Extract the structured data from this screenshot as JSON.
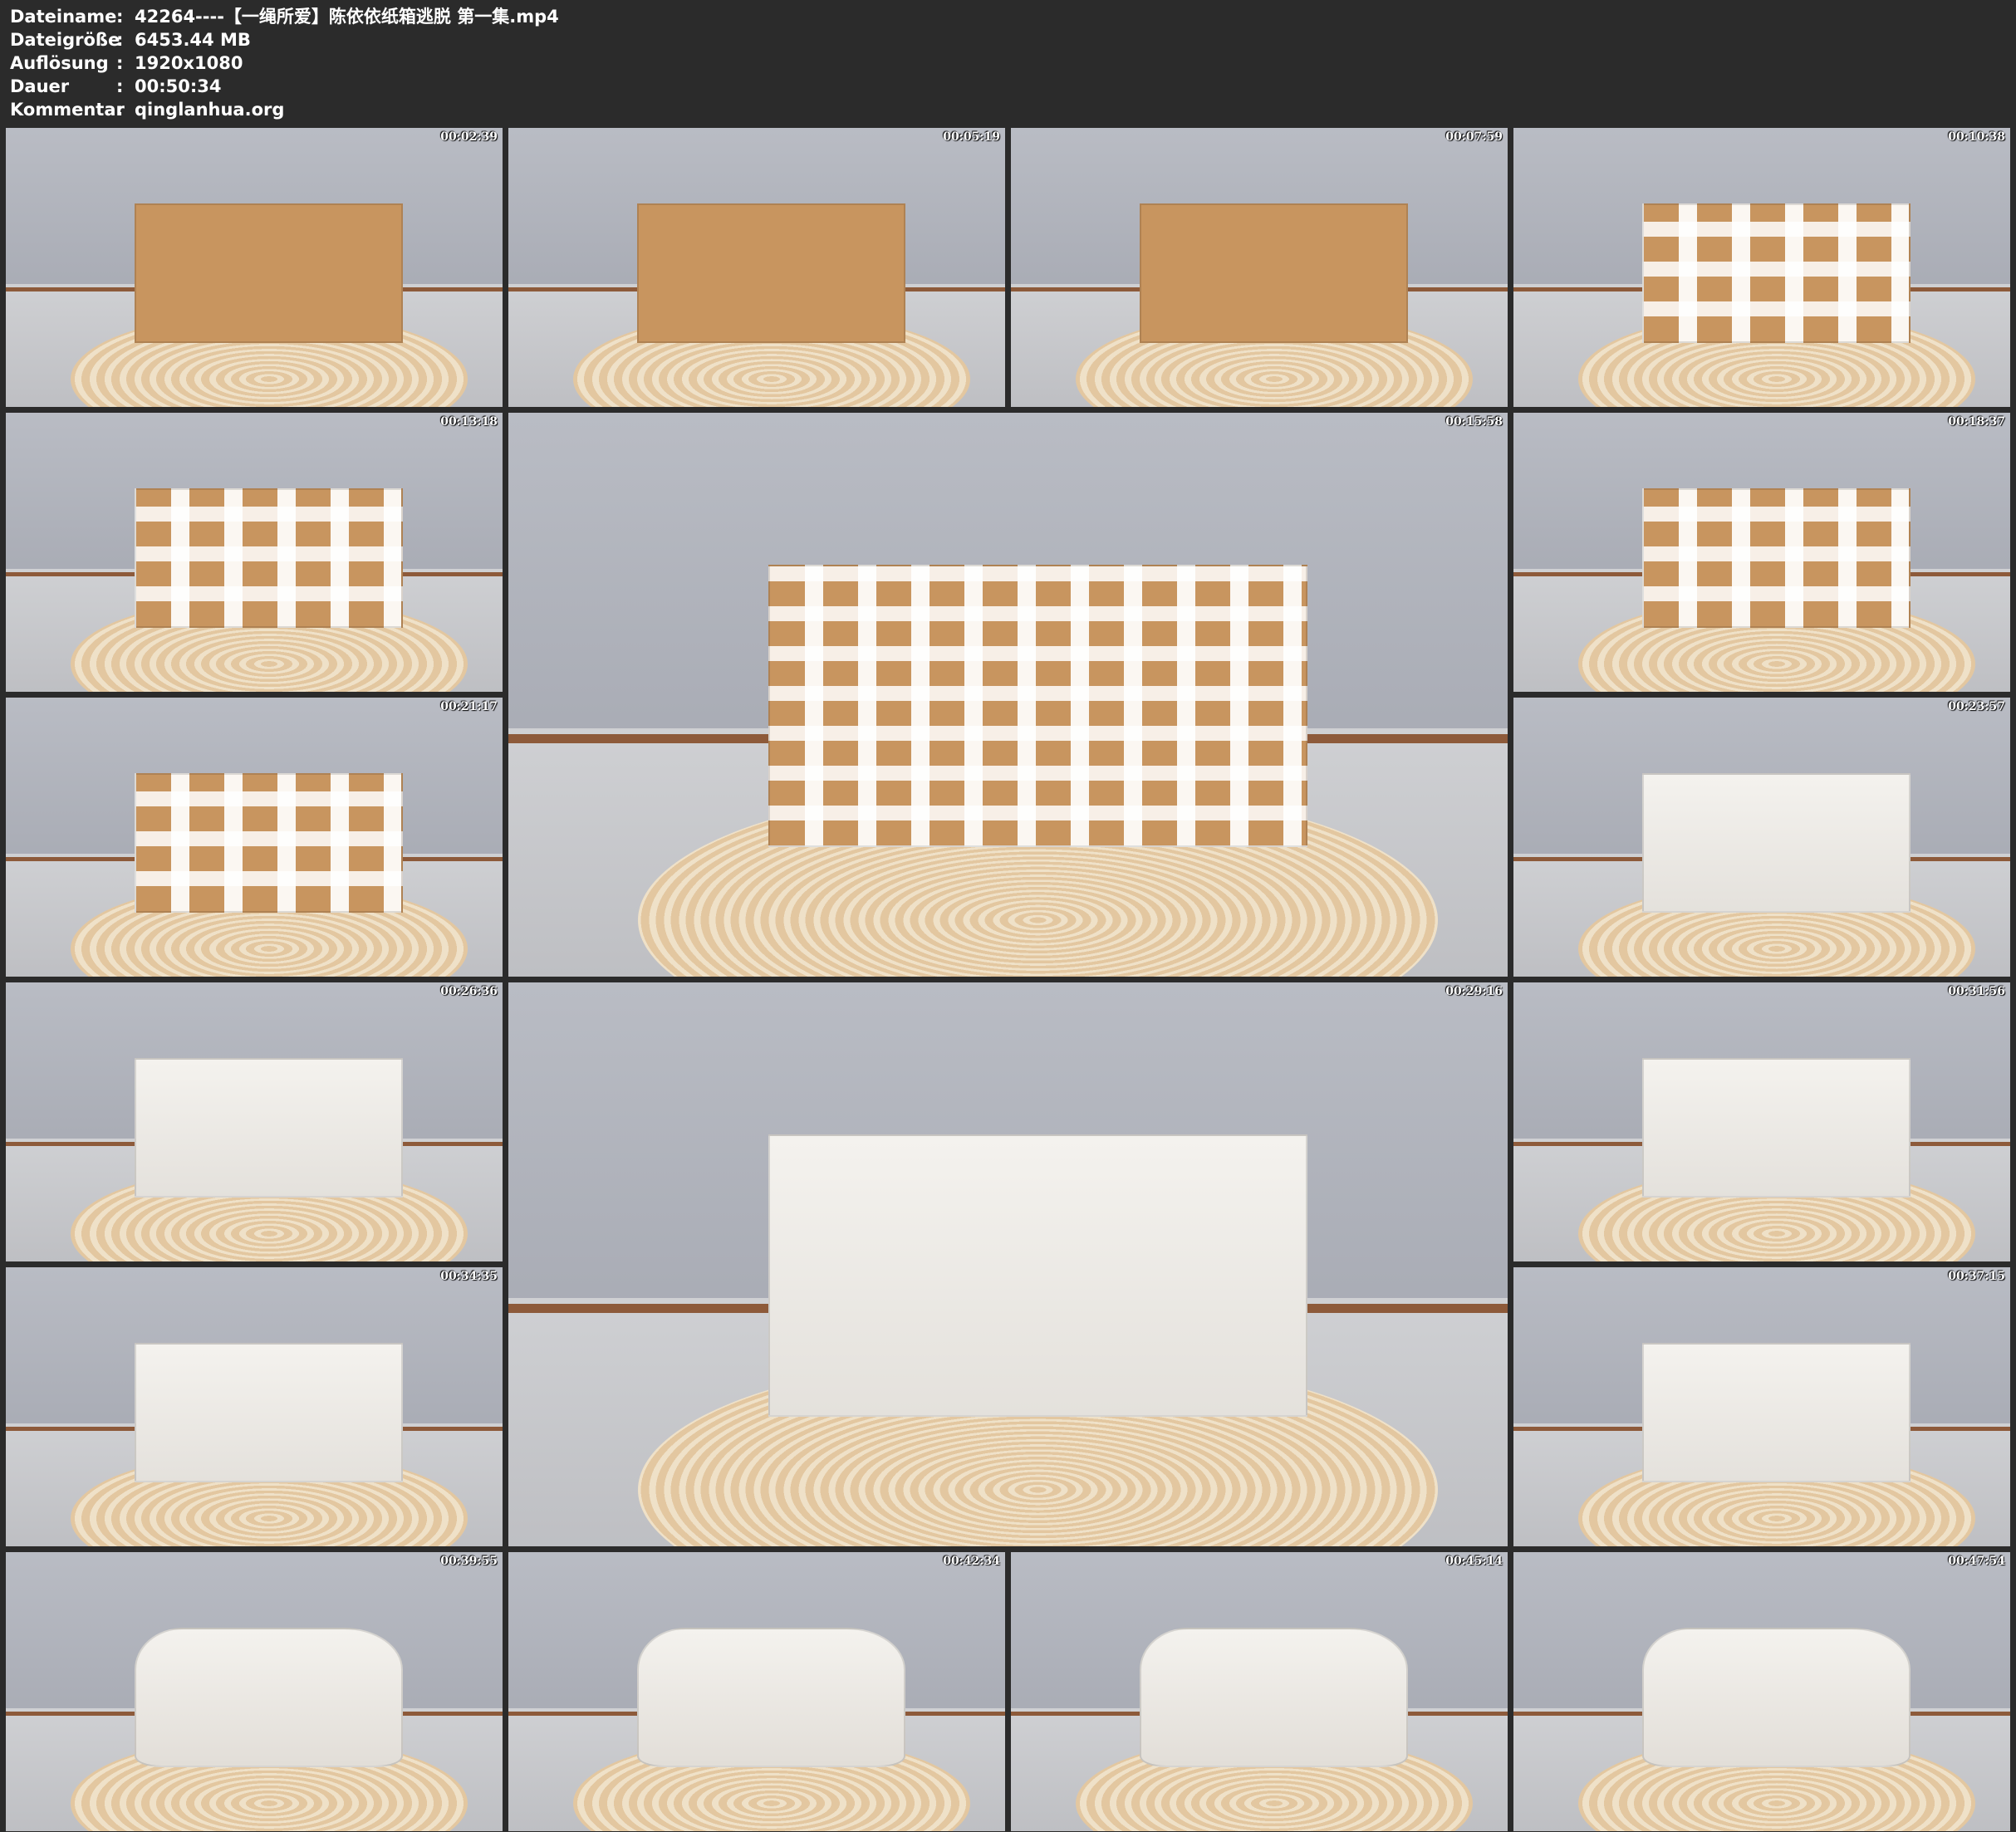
{
  "header": {
    "rows": [
      {
        "label": "Dateiname",
        "colon": ":",
        "value": "42264----【一绳所爱】陈依依纸箱逃脱 第一集.mp4"
      },
      {
        "label": "Dateigröße",
        "colon": ":",
        "value": "6453.44 MB"
      },
      {
        "label": "Auflösung",
        "colon": ":",
        "value": "1920x1080"
      },
      {
        "label": "Dauer",
        "colon": ":",
        "value": "00:50:34"
      },
      {
        "label": "Kommentar",
        "colon": ":",
        "value": "qinglanhua.org"
      }
    ]
  },
  "thumbnails": [
    {
      "timestamp": "00:02:39",
      "stage": "cardboard"
    },
    {
      "timestamp": "00:05:19",
      "stage": "cardboard"
    },
    {
      "timestamp": "00:07:59",
      "stage": "cardboard"
    },
    {
      "timestamp": "00:10:38",
      "stage": "taped"
    },
    {
      "timestamp": "00:13:18",
      "stage": "taped"
    },
    {
      "timestamp": "00:15:58",
      "stage": "taped"
    },
    {
      "timestamp": "00:18:37",
      "stage": "taped"
    },
    {
      "timestamp": "00:21:17",
      "stage": "taped"
    },
    {
      "timestamp": "00:23:57",
      "stage": "wrapped"
    },
    {
      "timestamp": "00:26:36",
      "stage": "wrapped"
    },
    {
      "timestamp": "00:29:16",
      "stage": "wrapped"
    },
    {
      "timestamp": "00:31:56",
      "stage": "wrapped"
    },
    {
      "timestamp": "00:34:35",
      "stage": "wrapped"
    },
    {
      "timestamp": "00:37:15",
      "stage": "wrapped"
    },
    {
      "timestamp": "00:39:55",
      "stage": "deformed"
    },
    {
      "timestamp": "00:42:34",
      "stage": "deformed"
    },
    {
      "timestamp": "00:45:14",
      "stage": "deformed"
    },
    {
      "timestamp": "00:47:54",
      "stage": "deformed"
    }
  ],
  "colors": {
    "background": "#2b2b2b",
    "header_text": "#ffffff",
    "timestamp_text": "#ffffff",
    "cardboard": "#c8955f",
    "tape": "#ffffff"
  }
}
